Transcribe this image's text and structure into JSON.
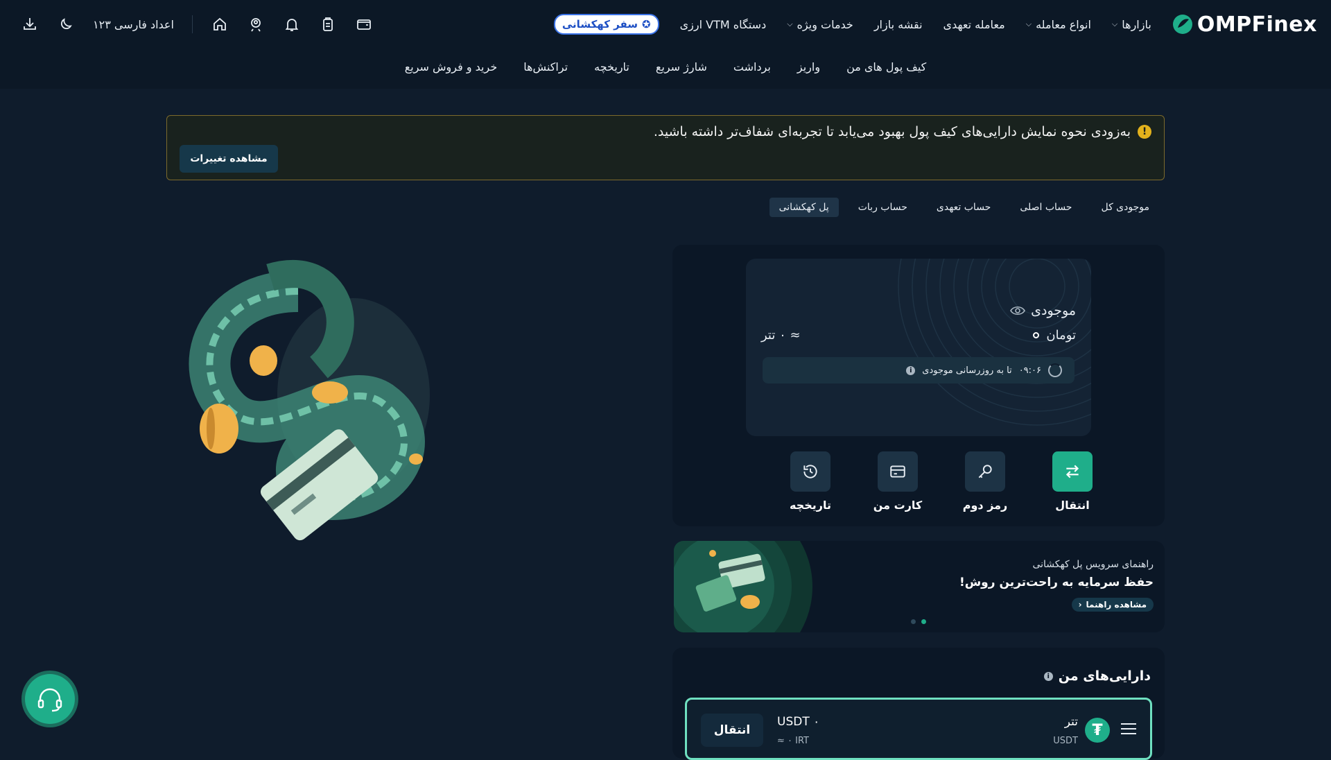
{
  "header": {
    "logo_text": "OMPFinex",
    "nav": [
      {
        "label": "بازارها",
        "has_dropdown": true
      },
      {
        "label": "انواع معامله",
        "has_dropdown": true
      },
      {
        "label": "معامله تعهدی",
        "has_dropdown": false
      },
      {
        "label": "نقشه بازار",
        "has_dropdown": false
      },
      {
        "label": "خدمات ویژه",
        "has_dropdown": true
      },
      {
        "label": "دستگاه VTM ارزی",
        "has_dropdown": false
      }
    ],
    "promo_label": "سفر کهکشانی",
    "lang_label": "اعداد فارسی ۱۲۳",
    "icons": [
      "wallet-icon",
      "clipboard-icon",
      "bell-icon",
      "user-badge-icon",
      "home-icon",
      "moon-icon",
      "download-icon"
    ]
  },
  "subnav": [
    "کیف پول های من",
    "واریز",
    "برداشت",
    "شارژ سریع",
    "تاریخچه",
    "تراکنش‌ها",
    "خرید و فروش سریع"
  ],
  "banner": {
    "text": "به‌زودی نحوه نمایش دارایی‌های کیف پول بهبود می‌یابد تا تجربه‌ای شفاف‌تر داشته باشید.",
    "button": "مشاهده تغییرات"
  },
  "tabs": [
    {
      "label": "موجودی کل",
      "active": false
    },
    {
      "label": "حساب اصلی",
      "active": false
    },
    {
      "label": "حساب تعهدی",
      "active": false
    },
    {
      "label": "حساب ربات",
      "active": false
    },
    {
      "label": "پل کهکشانی",
      "active": true
    }
  ],
  "balance": {
    "title": "موجودی",
    "toman": "تومان",
    "tether": "≈ ۰ تتر",
    "countdown": "۰۹:۰۶",
    "refresh_text": "تا به روزرسانی موجودی"
  },
  "actions": [
    {
      "label": "انتقال",
      "icon": "transfer-icon",
      "primary": true
    },
    {
      "label": "رمز دوم",
      "icon": "key-icon",
      "primary": false
    },
    {
      "label": "کارت من",
      "icon": "card-icon",
      "primary": false
    },
    {
      "label": "تاریخچه",
      "icon": "history-icon",
      "primary": false
    }
  ],
  "guide": {
    "subtitle": "راهنمای سرویس پل کهکشانی",
    "title": "حفظ سرمایه به راحت‌ترین روش!",
    "button": "مشاهده راهنما"
  },
  "assets": {
    "title": "دارایی‌های من",
    "rows": [
      {
        "name": "تتر",
        "code": "USDT",
        "amount": "USDT ۰",
        "irt": "≈ ۰ IRT",
        "button": "انتقال"
      }
    ]
  },
  "colors": {
    "accent": "#1fae8a",
    "background": "#0f1c2c",
    "warning": "#e3b21c"
  }
}
